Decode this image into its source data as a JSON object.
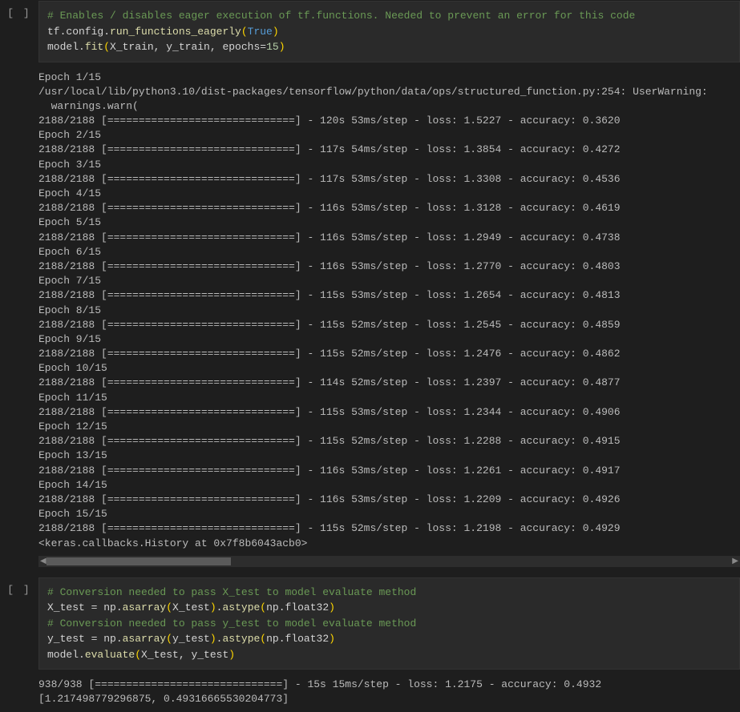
{
  "cell1": {
    "exec_label": "[ ]",
    "code": {
      "c1": "# Enables / disables eager execution of tf.functions. Needed to prevent an error for this code",
      "l2a": "tf.config.",
      "l2b": "run_functions_eagerly",
      "l2c": "(",
      "l2d": "True",
      "l2e": ")",
      "l3a": "model.",
      "l3b": "fit",
      "l3c": "(",
      "l3d": "X_train, y_train, epochs=",
      "l3e": "15",
      "l3f": ")"
    },
    "output_lines": [
      "Epoch 1/15",
      "/usr/local/lib/python3.10/dist-packages/tensorflow/python/data/ops/structured_function.py:254: UserWarning:",
      "  warnings.warn(",
      "2188/2188 [==============================] - 120s 53ms/step - loss: 1.5227 - accuracy: 0.3620",
      "Epoch 2/15",
      "2188/2188 [==============================] - 117s 54ms/step - loss: 1.3854 - accuracy: 0.4272",
      "Epoch 3/15",
      "2188/2188 [==============================] - 117s 53ms/step - loss: 1.3308 - accuracy: 0.4536",
      "Epoch 4/15",
      "2188/2188 [==============================] - 116s 53ms/step - loss: 1.3128 - accuracy: 0.4619",
      "Epoch 5/15",
      "2188/2188 [==============================] - 116s 53ms/step - loss: 1.2949 - accuracy: 0.4738",
      "Epoch 6/15",
      "2188/2188 [==============================] - 116s 53ms/step - loss: 1.2770 - accuracy: 0.4803",
      "Epoch 7/15",
      "2188/2188 [==============================] - 115s 53ms/step - loss: 1.2654 - accuracy: 0.4813",
      "Epoch 8/15",
      "2188/2188 [==============================] - 115s 52ms/step - loss: 1.2545 - accuracy: 0.4859",
      "Epoch 9/15",
      "2188/2188 [==============================] - 115s 52ms/step - loss: 1.2476 - accuracy: 0.4862",
      "Epoch 10/15",
      "2188/2188 [==============================] - 114s 52ms/step - loss: 1.2397 - accuracy: 0.4877",
      "Epoch 11/15",
      "2188/2188 [==============================] - 115s 53ms/step - loss: 1.2344 - accuracy: 0.4906",
      "Epoch 12/15",
      "2188/2188 [==============================] - 115s 52ms/step - loss: 1.2288 - accuracy: 0.4915",
      "Epoch 13/15",
      "2188/2188 [==============================] - 116s 53ms/step - loss: 1.2261 - accuracy: 0.4917",
      "Epoch 14/15",
      "2188/2188 [==============================] - 116s 53ms/step - loss: 1.2209 - accuracy: 0.4926",
      "Epoch 15/15",
      "2188/2188 [==============================] - 115s 52ms/step - loss: 1.2198 - accuracy: 0.4929",
      "<keras.callbacks.History at 0x7f8b6043acb0>"
    ]
  },
  "cell2": {
    "exec_label": "[ ]",
    "code": {
      "c1": "# Conversion needed to pass X_test to model evaluate method",
      "l2a": "X_test = np.",
      "l2b": "asarray",
      "l2c": "(",
      "l2d": "X_test",
      "l2e": ")",
      "l2f": ".",
      "l2g": "astype",
      "l2h": "(",
      "l2i": "np.float32",
      "l2j": ")",
      "c3": "# Conversion needed to pass y_test to model evaluate method",
      "l4a": "y_test = np.",
      "l4b": "asarray",
      "l4c": "(",
      "l4d": "y_test",
      "l4e": ")",
      "l4f": ".",
      "l4g": "astype",
      "l4h": "(",
      "l4i": "np.float32",
      "l4j": ")",
      "l5a": "model.",
      "l5b": "evaluate",
      "l5c": "(",
      "l5d": "X_test, y_test",
      "l5e": ")"
    },
    "output_lines": [
      "938/938 [==============================] - 15s 15ms/step - loss: 1.2175 - accuracy: 0.4932",
      "[1.217498779296875, 0.49316665530204773]"
    ]
  }
}
